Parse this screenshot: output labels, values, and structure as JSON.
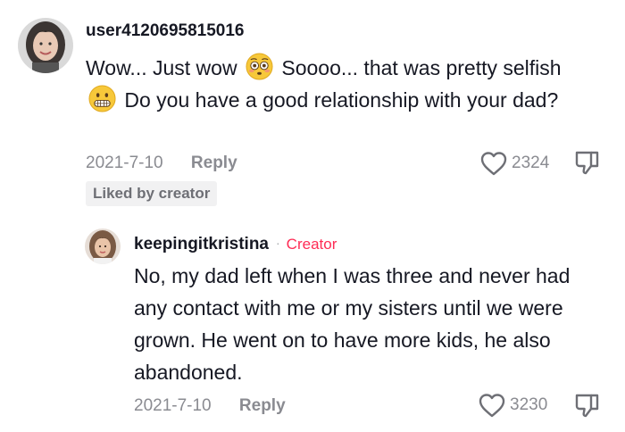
{
  "comment": {
    "username": "user4120695815016",
    "text_part1": "Wow... Just wow",
    "emoji1": "flushed-face-emoji",
    "text_part2": "Soooo... that was pretty selfish",
    "emoji2": "grimacing-face-emoji",
    "text_part3": "Do you have a good relationship with your dad?",
    "date": "2021-7-10",
    "reply_label": "Reply",
    "like_count": "2324",
    "liked_badge": "Liked by creator"
  },
  "reply": {
    "username": "keepingitkristina",
    "separator": "·",
    "badge": "Creator",
    "text": "No, my dad left when I was three and never had any contact with me or my sisters until we were grown. He went on to have more kids, he also abandoned.",
    "date": "2021-7-10",
    "reply_label": "Reply",
    "like_count": "3230"
  },
  "colors": {
    "creator_accent": "#fe2c55",
    "muted_text": "#8a8b91",
    "badge_bg": "#f1f1f2"
  },
  "icons": [
    "heart-outline-icon",
    "thumbs-down-icon"
  ]
}
